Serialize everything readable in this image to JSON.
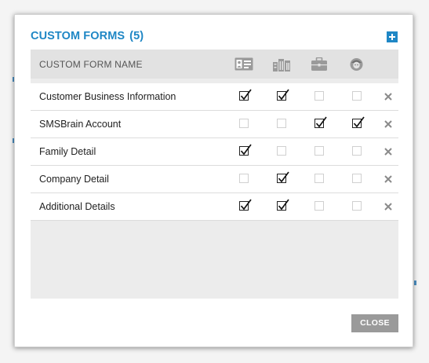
{
  "dialog": {
    "title": "CUSTOM FORMS",
    "count": "(5)",
    "close_label": "CLOSE"
  },
  "table": {
    "column_header": "CUSTOM FORM NAME",
    "icon_columns": [
      "contact-card-icon",
      "buildings-icon",
      "briefcase-icon",
      "person-icon"
    ],
    "rows": [
      {
        "name": "Customer Business Information",
        "checks": [
          true,
          true,
          false,
          false
        ]
      },
      {
        "name": "SMSBrain Account",
        "checks": [
          false,
          false,
          true,
          true
        ]
      },
      {
        "name": "Family Detail",
        "checks": [
          true,
          false,
          false,
          false
        ]
      },
      {
        "name": "Company Detail",
        "checks": [
          false,
          true,
          false,
          false
        ]
      },
      {
        "name": "Additional Details",
        "checks": [
          true,
          true,
          false,
          false
        ]
      }
    ]
  },
  "colors": {
    "accent": "#1f87c5",
    "header_bg": "#e2e2e2",
    "panel_bg": "#ececec",
    "close_button": "#9a9a9a"
  }
}
